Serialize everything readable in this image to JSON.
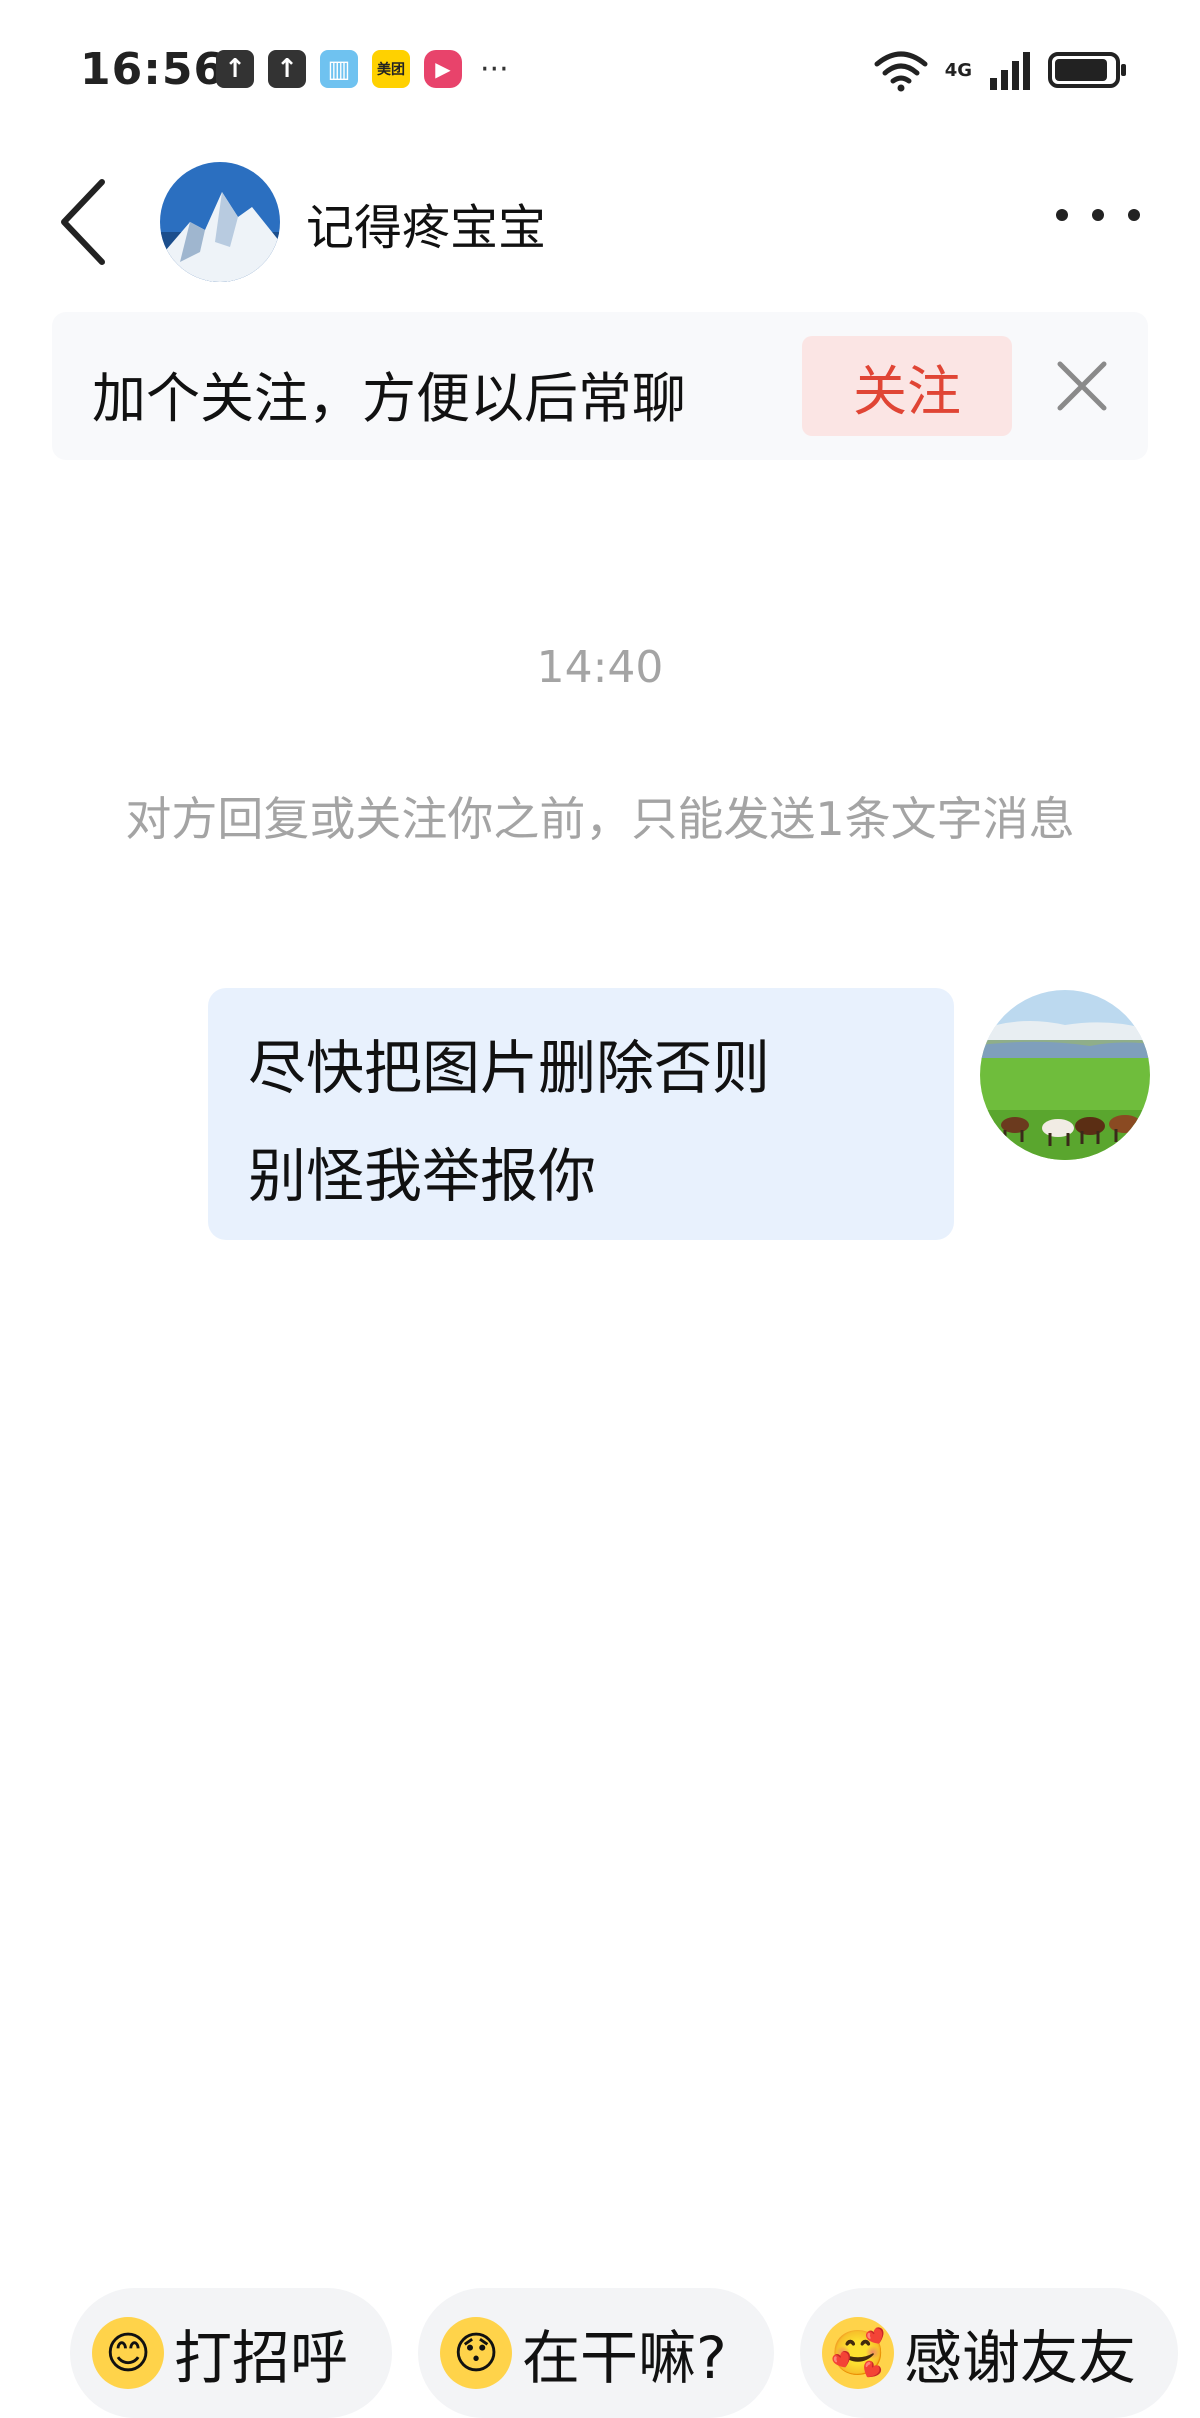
{
  "status_bar": {
    "time": "16:56",
    "notification_icons": [
      "upload-icon",
      "upload-icon",
      "book-icon",
      "meituan-icon",
      "video-icon"
    ],
    "meituan_label": "美团",
    "more": "···",
    "network": "4G",
    "battery_level": 0.9
  },
  "header": {
    "back_icon": "chevron-left-icon",
    "contact_name": "记得疼宝宝",
    "more_icon": "more-dots-icon"
  },
  "follow_banner": {
    "text": "加个关注，方便以后常聊",
    "follow_label": "关注",
    "close_icon": "close-icon",
    "accent_color": "#e04535"
  },
  "chat": {
    "timestamp": "14:40",
    "notice": "对方回复或关注你之前，只能发送1条文字消息",
    "messages": [
      {
        "sender": "me",
        "lines": [
          "尽快把图片删除否则",
          "别怪我举报你"
        ]
      }
    ]
  },
  "quick_replies": [
    {
      "emoji": "😊",
      "label": "打招呼"
    },
    {
      "emoji": "😯",
      "label": "在干嘛?"
    },
    {
      "emoji": "🥰",
      "label": "感谢友友"
    }
  ]
}
